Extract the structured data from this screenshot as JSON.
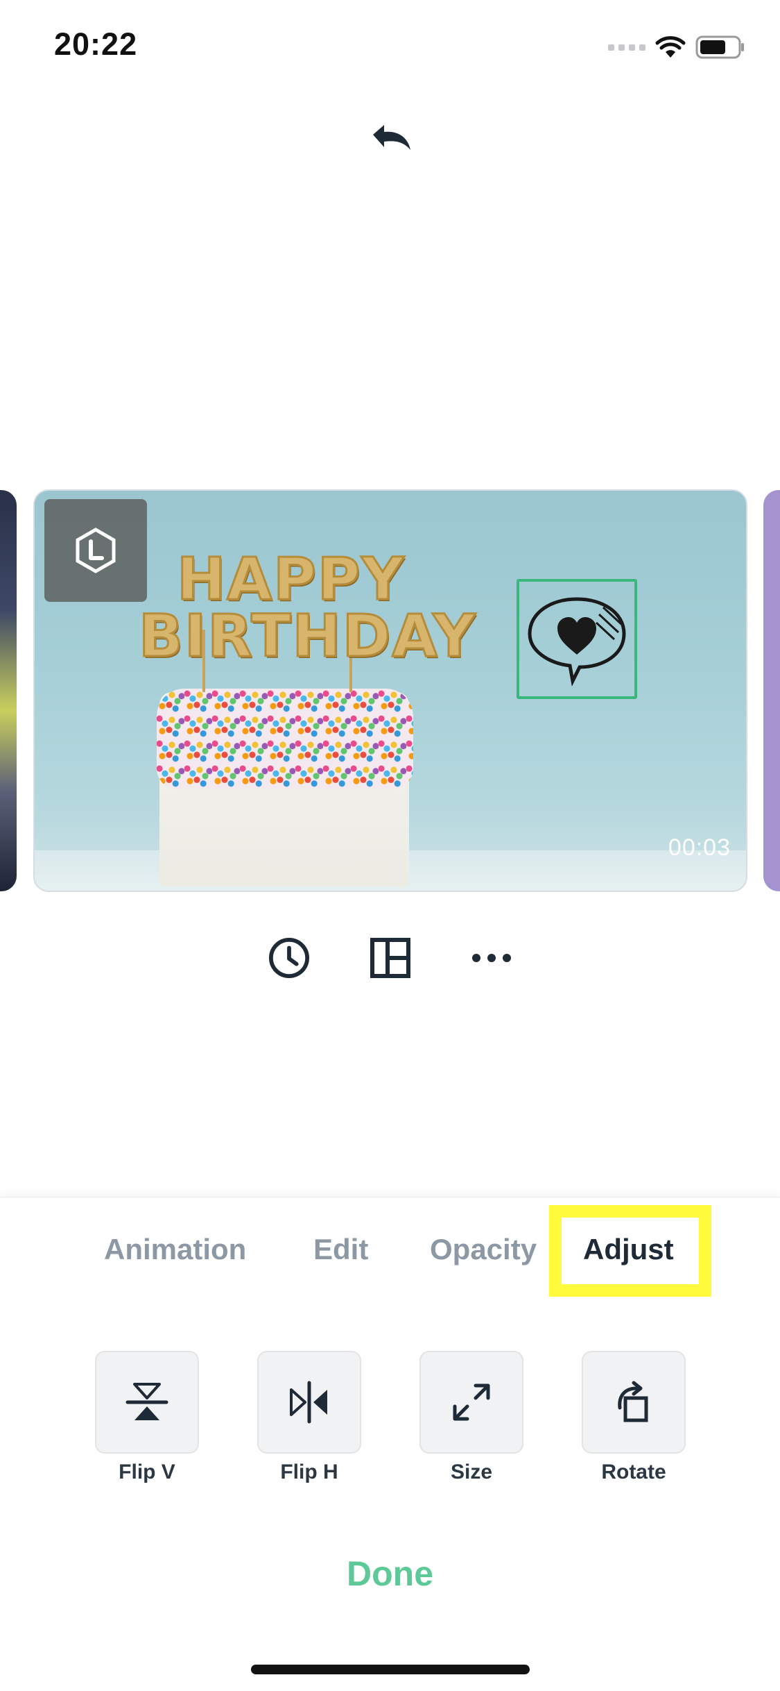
{
  "status_bar": {
    "time": "20:22",
    "icons": [
      "cellular-signal-icon",
      "wifi-icon",
      "battery-icon"
    ]
  },
  "header": {
    "undo_icon": "undo-icon"
  },
  "clip": {
    "logo_badge_icon": "hexagon-l-logo-icon",
    "cake_text_line1": "HAPPY",
    "cake_text_line2": "BIRTHDAY",
    "sticker_icon": "speech-bubble-heart-icon",
    "duration": "00:03",
    "selection_color": "#3bb77e"
  },
  "clip_tools": [
    {
      "icon": "clock-icon"
    },
    {
      "icon": "layout-icon"
    },
    {
      "icon": "more-icon"
    }
  ],
  "tabs": [
    {
      "label": "Animation"
    },
    {
      "label": "Edit"
    },
    {
      "label": "Opacity"
    },
    {
      "label": "Adjust",
      "active": true
    }
  ],
  "actions": [
    {
      "label": "Flip V",
      "icon": "flip-vertical-icon"
    },
    {
      "label": "Flip H",
      "icon": "flip-horizontal-icon"
    },
    {
      "label": "Size",
      "icon": "resize-icon"
    },
    {
      "label": "Rotate",
      "icon": "rotate-icon"
    }
  ],
  "done_label": "Done",
  "colors": {
    "accent_green": "#5ec998",
    "highlight_yellow": "#fffa3b",
    "text_dark": "#1f2a37",
    "text_muted": "#8c98a4"
  }
}
